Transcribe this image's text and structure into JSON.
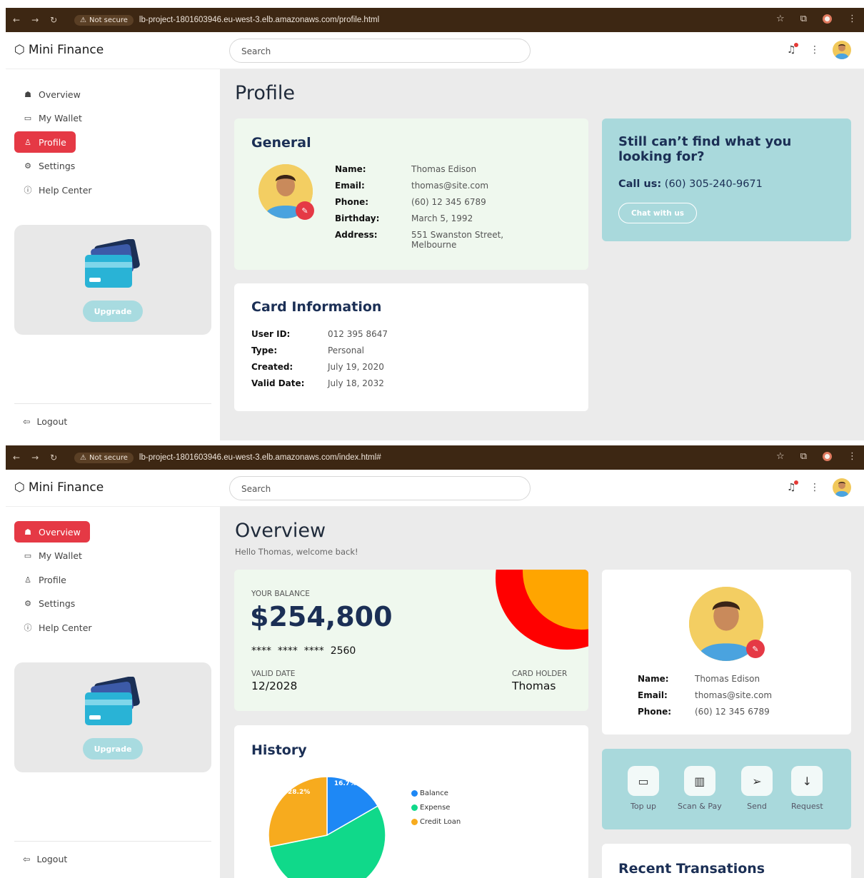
{
  "browser": {
    "not_secure": "Not secure",
    "url_profile": "lb-project-1801603946.eu-west-3.elb.amazonaws.com/profile.html",
    "url_index": "lb-project-1801603946.eu-west-3.elb.amazonaws.com/index.html#"
  },
  "app": {
    "name": "Mini Finance",
    "search_placeholder": "Search"
  },
  "sidebar": {
    "items": [
      {
        "label": "Overview",
        "icon": "home-icon"
      },
      {
        "label": "My Wallet",
        "icon": "wallet-icon"
      },
      {
        "label": "Profile",
        "icon": "user-icon"
      },
      {
        "label": "Settings",
        "icon": "gear-icon"
      },
      {
        "label": "Help Center",
        "icon": "help-icon"
      }
    ],
    "upgrade": "Upgrade",
    "logout": "Logout"
  },
  "profile_page": {
    "title": "Profile",
    "general": {
      "title": "General",
      "fields": [
        {
          "k": "Name:",
          "v": "Thomas Edison"
        },
        {
          "k": "Email:",
          "v": "thomas@site.com"
        },
        {
          "k": "Phone:",
          "v": "(60) 12 345 6789"
        },
        {
          "k": "Birthday:",
          "v": "March 5, 1992"
        },
        {
          "k": "Address:",
          "v": "551 Swanston Street, Melbourne"
        }
      ]
    },
    "card_info": {
      "title": "Card Information",
      "fields": [
        {
          "k": "User ID:",
          "v": "012 395 8647"
        },
        {
          "k": "Type:",
          "v": "Personal"
        },
        {
          "k": "Created:",
          "v": "July 19, 2020"
        },
        {
          "k": "Valid Date:",
          "v": "July 18, 2032"
        }
      ]
    },
    "help": {
      "title": "Still can’t find what you looking for?",
      "call_label": "Call us:",
      "call_number": "(60) 305-240-9671",
      "chat": "Chat with us"
    }
  },
  "overview_page": {
    "title": "Overview",
    "subtitle": "Hello Thomas, welcome back!",
    "balance": {
      "label": "YOUR BALANCE",
      "amount": "$254,800",
      "card_masked": "****  ****  ****  2560",
      "valid_label": "VALID DATE",
      "valid_value": "12/2028",
      "holder_label": "CARD HOLDER",
      "holder_value": "Thomas"
    },
    "user": {
      "fields": [
        {
          "k": "Name:",
          "v": "Thomas Edison"
        },
        {
          "k": "Email:",
          "v": "thomas@site.com"
        },
        {
          "k": "Phone:",
          "v": "(60) 12 345 6789"
        }
      ]
    },
    "actions": [
      {
        "label": "Top up",
        "icon": "wallet-icon"
      },
      {
        "label": "Scan & Pay",
        "icon": "barcode-icon"
      },
      {
        "label": "Send",
        "icon": "send-icon"
      },
      {
        "label": "Request",
        "icon": "arrow-down-icon"
      }
    ],
    "history_title": "History",
    "recent_title": "Recent Transations"
  },
  "chart_data": {
    "type": "pie",
    "title": "",
    "categories": [
      "Balance",
      "Expense",
      "Credit Loan"
    ],
    "values": [
      16.7,
      55.1,
      28.2
    ],
    "data_labels": [
      "16.7%",
      "",
      "28.2%"
    ],
    "colors": [
      "#1e88f5",
      "#10d98a",
      "#f7ab1e"
    ],
    "legend_position": "right"
  }
}
